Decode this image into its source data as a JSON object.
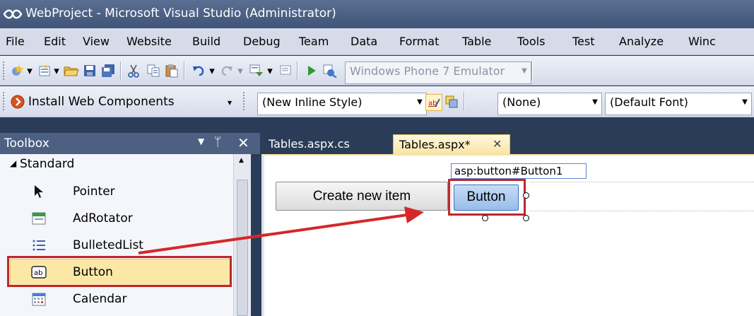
{
  "window": {
    "title": "WebProject - Microsoft Visual Studio (Administrator)"
  },
  "menu": [
    "File",
    "Edit",
    "View",
    "Website",
    "Build",
    "Debug",
    "Team",
    "Data",
    "Format",
    "Table",
    "Tools",
    "Test",
    "Analyze",
    "Winc"
  ],
  "toolbar1": {
    "target_device": "Windows Phone 7 Emulator"
  },
  "toolbar2": {
    "install_label": "Install Web Components",
    "style_value": "(New Inline Style)",
    "target_rule_value": "(None)",
    "font_value": "(Default Font)"
  },
  "toolbox": {
    "title": "Toolbox",
    "group": "Standard",
    "items": [
      {
        "label": "Pointer",
        "icon": "pointer-arrow-icon"
      },
      {
        "label": "AdRotator",
        "icon": "adrotator-icon"
      },
      {
        "label": "BulletedList",
        "icon": "bulleted-list-icon"
      },
      {
        "label": "Button",
        "icon": "button-ab-icon"
      },
      {
        "label": "Calendar",
        "icon": "calendar-icon"
      }
    ]
  },
  "tabs": [
    {
      "label": "Tables.aspx.cs",
      "active": false
    },
    {
      "label": "Tables.aspx*",
      "active": true
    }
  ],
  "design": {
    "tag_label": "asp:button#Button1",
    "create_button": "Create new item",
    "new_button": "Button"
  },
  "colors": {
    "highlight_red": "#c0272d",
    "arrow_red": "#d42828",
    "selected_item": "#fbe7a6"
  }
}
